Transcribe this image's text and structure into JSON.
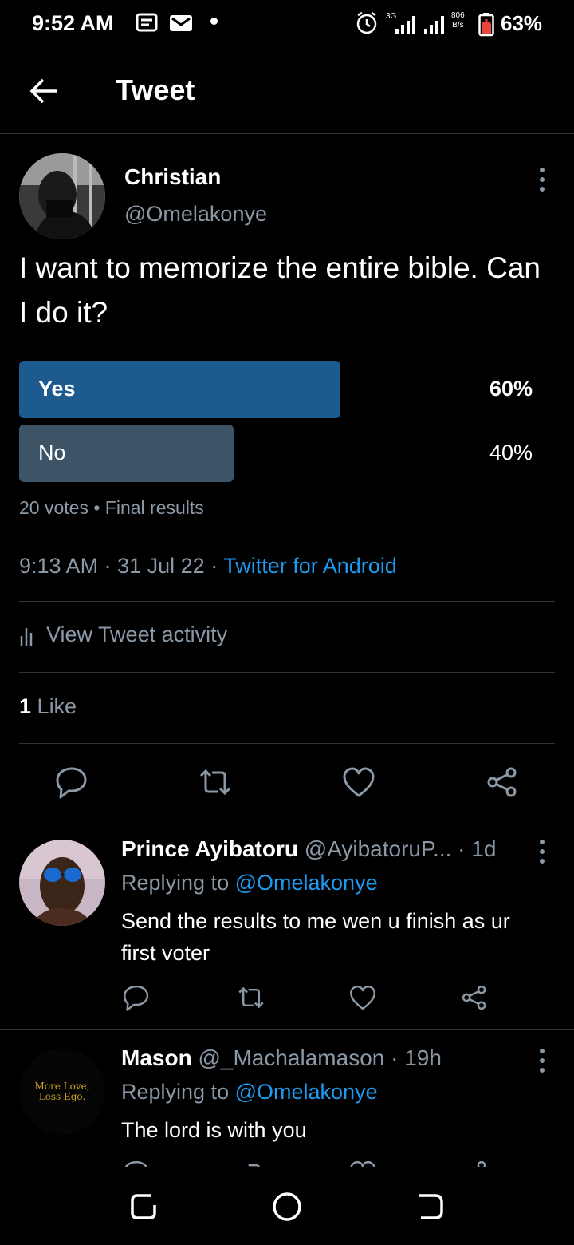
{
  "status_bar": {
    "time": "9:52 AM",
    "network_type": "3G",
    "data_speed_value": "806",
    "data_speed_unit": "B/s",
    "battery": "63%"
  },
  "header": {
    "title": "Tweet"
  },
  "tweet": {
    "author_name": "Christian",
    "author_handle": "@Omelakonye",
    "text": "I want to memorize the entire bible. Can I do it?",
    "poll": {
      "options": [
        {
          "label": "Yes",
          "percent": "60%",
          "fraction": 0.6,
          "color": "#1d5a8f",
          "winner": true
        },
        {
          "label": "No",
          "percent": "40%",
          "fraction": 0.4,
          "color": "#3d5466",
          "winner": false
        }
      ],
      "votes": "20 votes",
      "status": "Final results"
    },
    "time": "9:13 AM",
    "date": "31 Jul 22",
    "source": "Twitter for Android",
    "activity_label": "View Tweet activity",
    "likes_count": "1",
    "likes_label": "Like"
  },
  "replies": [
    {
      "name": "Prince Ayibatoru",
      "handle": "@AyibatoruP...",
      "age": "1d",
      "replying_prefix": "Replying to",
      "replying_to": "@Omelakonye",
      "text": "Send the results to me wen u finish as ur first voter"
    },
    {
      "name": "Mason",
      "handle": "@_Machalamason",
      "age": "19h",
      "replying_prefix": "Replying to",
      "replying_to": "@Omelakonye",
      "text": "The lord is with you",
      "avatar_text_line1": "More Love,",
      "avatar_text_line2": "Less Ego."
    }
  ],
  "colors": {
    "accent": "#1d9bf0",
    "background": "#000000",
    "muted": "#8b98a5"
  }
}
